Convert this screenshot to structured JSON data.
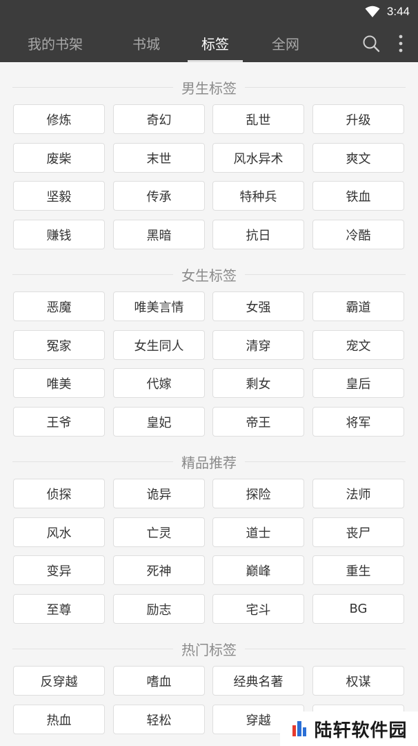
{
  "status": {
    "time": "3:44"
  },
  "tabs": [
    {
      "label": "我的书架",
      "active": false
    },
    {
      "label": "书城",
      "active": false
    },
    {
      "label": "标签",
      "active": true
    },
    {
      "label": "全网",
      "active": false
    }
  ],
  "sections": [
    {
      "title": "男生标签",
      "tags": [
        "修炼",
        "奇幻",
        "乱世",
        "升级",
        "废柴",
        "末世",
        "风水异术",
        "爽文",
        "坚毅",
        "传承",
        "特种兵",
        "铁血",
        "赚钱",
        "黑暗",
        "抗日",
        "冷酷"
      ]
    },
    {
      "title": "女生标签",
      "tags": [
        "恶魔",
        "唯美言情",
        "女强",
        "霸道",
        "冤家",
        "女生同人",
        "清穿",
        "宠文",
        "唯美",
        "代嫁",
        "剩女",
        "皇后",
        "王爷",
        "皇妃",
        "帝王",
        "将军"
      ]
    },
    {
      "title": "精品推荐",
      "tags": [
        "侦探",
        "诡异",
        "探险",
        "法师",
        "风水",
        "亡灵",
        "道士",
        "丧尸",
        "变异",
        "死神",
        "巅峰",
        "重生",
        "至尊",
        "励志",
        "宅斗",
        "BG"
      ]
    },
    {
      "title": "热门标签",
      "tags": [
        "反穿越",
        "嗜血",
        "经典名著",
        "权谋",
        "热血",
        "轻松",
        "穿越",
        ""
      ]
    }
  ],
  "watermark": {
    "text": "陆轩软件园"
  },
  "colors": {
    "appbar": "#3c3c3c",
    "background": "#f5f5f5",
    "tag_text": "#333333",
    "header_text": "#8a8a8a"
  }
}
